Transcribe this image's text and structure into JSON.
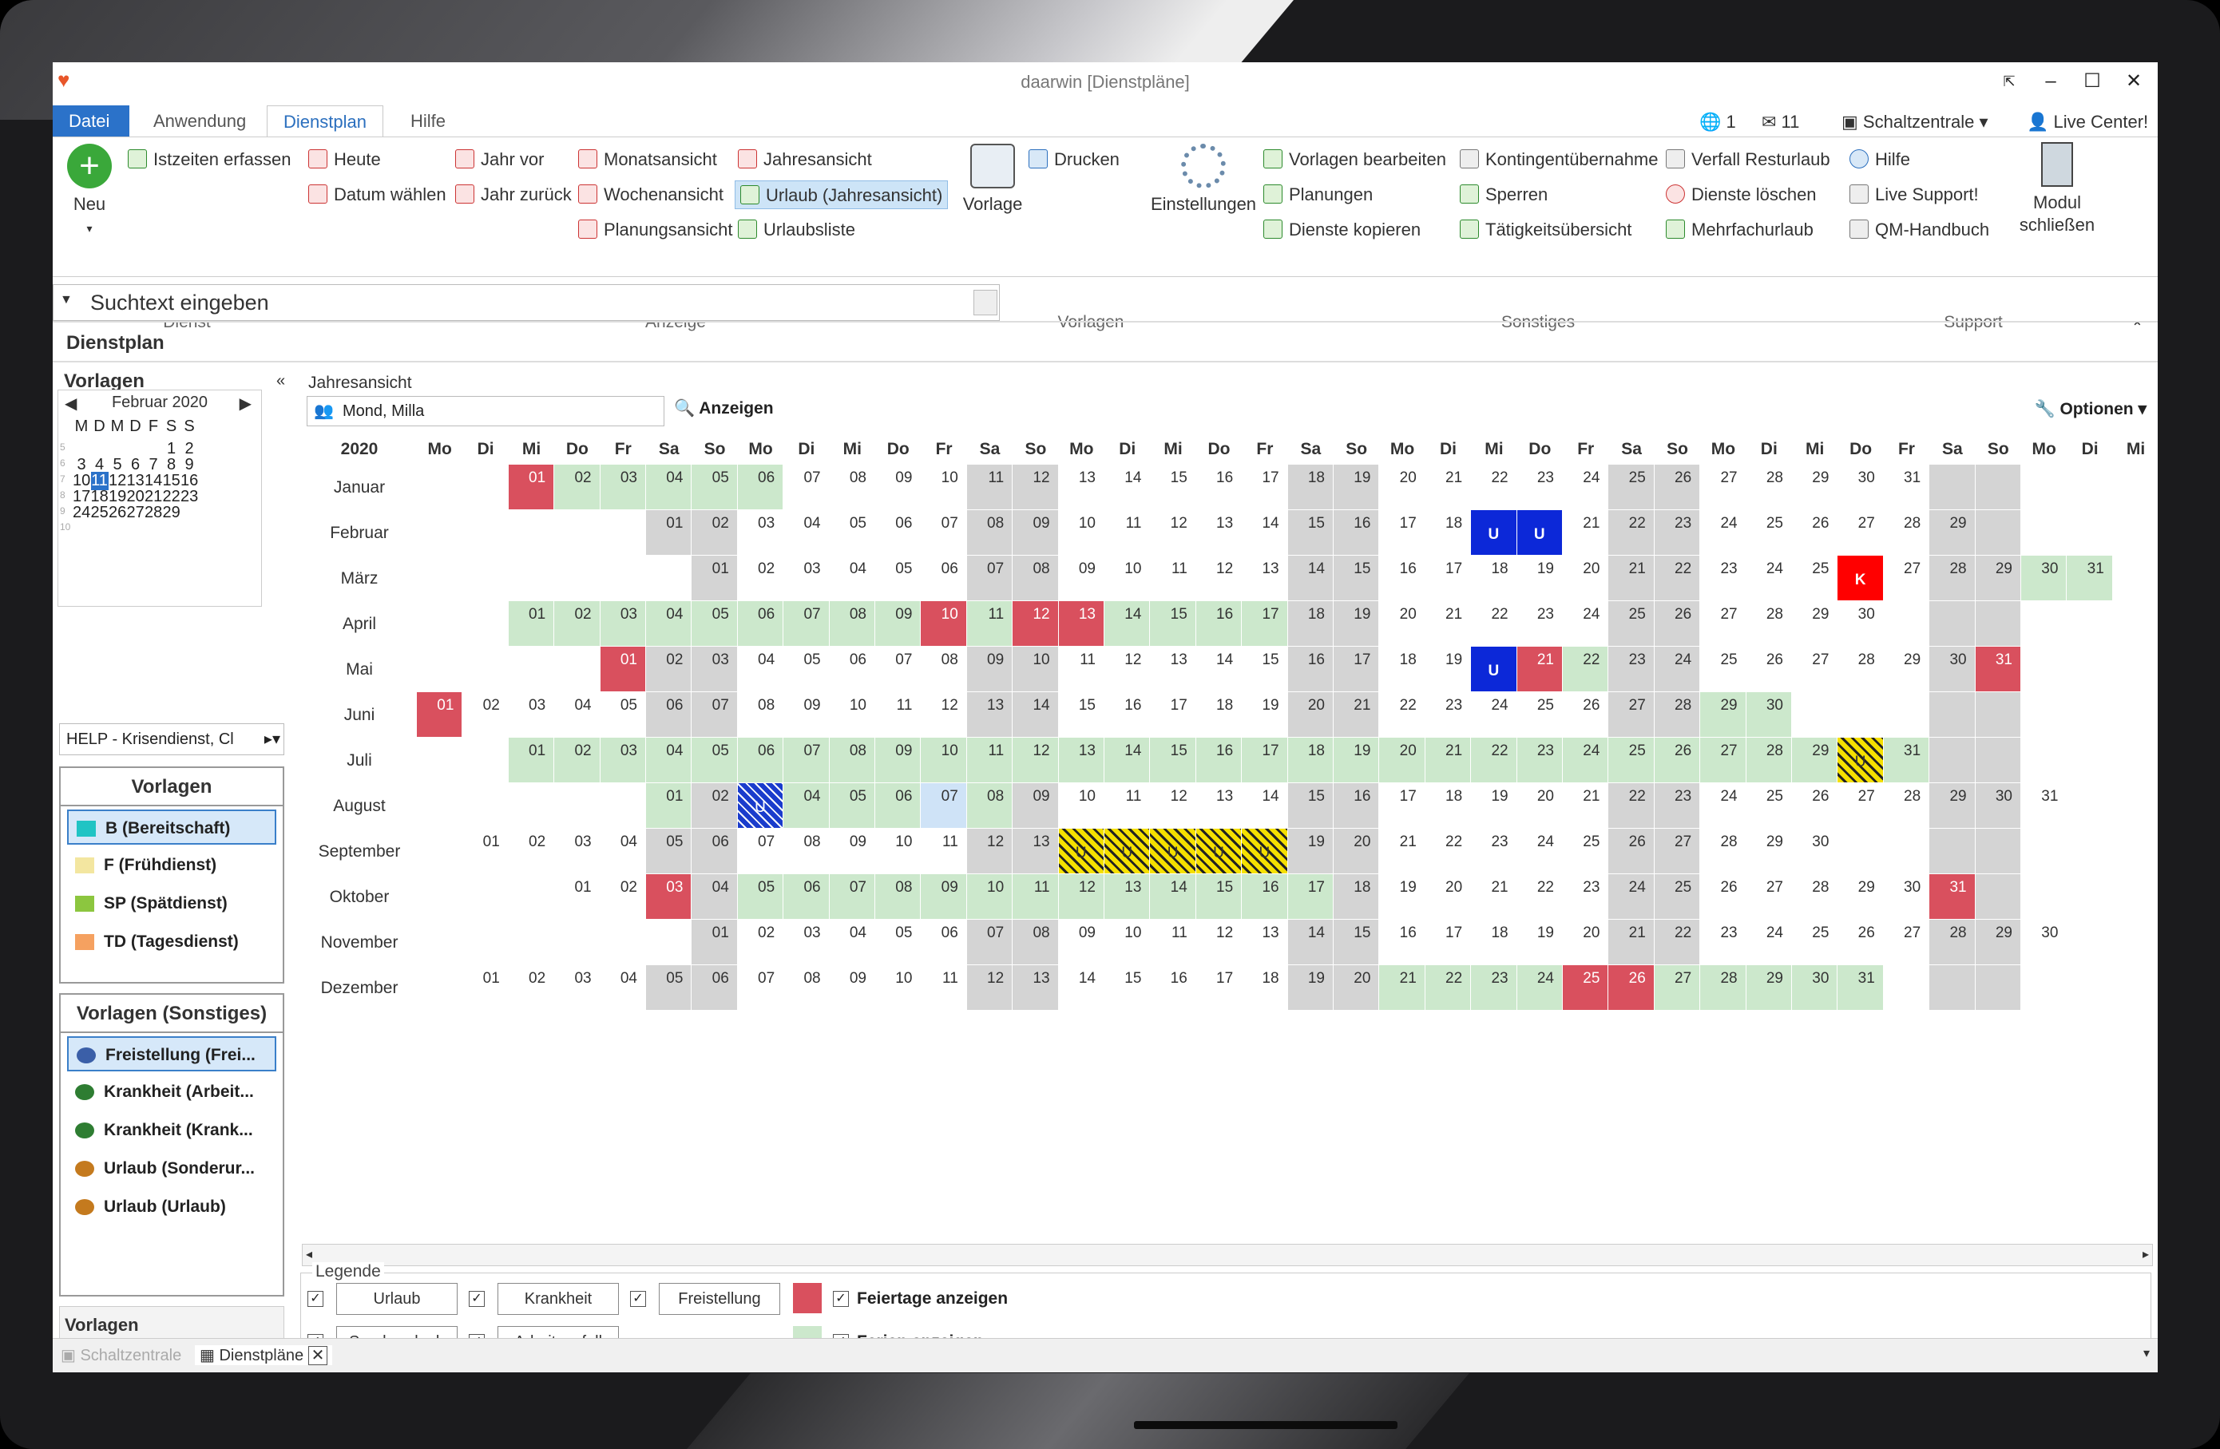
{
  "window": {
    "title": "daarwin [Dienstpläne]"
  },
  "tabs": [
    "Datei",
    "Anwendung",
    "Dienstplan",
    "Hilfe"
  ],
  "quick": {
    "c1": "1",
    "c2": "11",
    "schaltzentrale": "Schaltzentrale",
    "live": "Live Center!"
  },
  "ribbon": {
    "neu": "Neu",
    "istzeiten": "Istzeiten erfassen",
    "heute": "Heute",
    "datum": "Datum wählen",
    "jahrvor": "Jahr vor",
    "jahrzurueck": "Jahr zurück",
    "monat": "Monatsansicht",
    "woche": "Wochenansicht",
    "planung": "Planungsansicht",
    "jahr": "Jahresansicht",
    "urlaubjahr": "Urlaub (Jahresansicht)",
    "urlaubsliste": "Urlaubsliste",
    "vorlage": "Vorlage",
    "drucken": "Drucken",
    "einstellungen": "Einstellungen",
    "vorlagenbearb": "Vorlagen bearbeiten",
    "planungen": "Planungen",
    "kopieren": "Dienste kopieren",
    "kontingent": "Kontingentübernahme",
    "sperren": "Sperren",
    "taetigkeit": "Tätigkeitsübersicht",
    "verfall": "Verfall Resturlaub",
    "loeschen": "Dienste löschen",
    "mehrfach": "Mehrfachurlaub",
    "hilfe": "Hilfe",
    "livesupport": "Live Support!",
    "qm": "QM-Handbuch",
    "modul1": "Modul",
    "modul2": "schließen",
    "groups": {
      "dienst": "Dienst",
      "anzeige": "Anzeige",
      "vorlagen": "Vorlagen",
      "sonstiges": "Sonstiges",
      "support": "Support"
    }
  },
  "search": {
    "placeholder": "Suchtext eingeben"
  },
  "section": "Dienstplan",
  "left": {
    "vorlagen_title": "Vorlagen",
    "mini_month": "Februar 2020",
    "mini_days": [
      "M",
      "D",
      "M",
      "D",
      "F",
      "S",
      "S"
    ],
    "combo": "HELP - Krisendienst, Cl",
    "panel1_title": "Vorlagen",
    "panel1": [
      {
        "label": "B (Bereitschaft)",
        "color": "#20c4c4"
      },
      {
        "label": "F (Frühdienst)",
        "color": "#f3e6a0"
      },
      {
        "label": "SP (Spätdienst)",
        "color": "#8cc63f"
      },
      {
        "label": "TD (Tagesdienst)",
        "color": "#f5a160"
      }
    ],
    "panel2_title": "Vorlagen (Sonstiges)",
    "panel2": [
      "Freistellung  (Frei...",
      "Krankheit  (Arbeit...",
      "Krankheit  (Krank...",
      "Urlaub  (Sonderur...",
      "Urlaub (Urlaub)"
    ],
    "bottom": "Vorlagen"
  },
  "grid": {
    "title": "Jahresansicht",
    "person": "Mond, Milla",
    "anzeigen": "Anzeigen",
    "optionen": "Optionen",
    "year": "2020",
    "weekdays": [
      "Mo",
      "Di",
      "Mi",
      "Do",
      "Fr",
      "Sa",
      "So"
    ],
    "months": [
      {
        "name": "Januar",
        "off": 2,
        "days": 31
      },
      {
        "name": "Februar",
        "off": 5,
        "days": 29
      },
      {
        "name": "März",
        "off": 6,
        "days": 31
      },
      {
        "name": "April",
        "off": 2,
        "days": 30
      },
      {
        "name": "Mai",
        "off": 4,
        "days": 31
      },
      {
        "name": "Juni",
        "off": 0,
        "days": 30
      },
      {
        "name": "Juli",
        "off": 2,
        "days": 31
      },
      {
        "name": "August",
        "off": 5,
        "days": 31
      },
      {
        "name": "September",
        "off": 1,
        "days": 30
      },
      {
        "name": "Oktober",
        "off": 3,
        "days": 31
      },
      {
        "name": "November",
        "off": 6,
        "days": 30
      },
      {
        "name": "Dezember",
        "off": 1,
        "days": 31
      }
    ],
    "ferien": {
      "0": [
        2,
        3,
        4,
        5,
        6
      ],
      "3": [
        1,
        2,
        3,
        4,
        5,
        6,
        7,
        8,
        9,
        11,
        14,
        15,
        16,
        17
      ],
      "4": [
        22
      ],
      "5": [
        29,
        30
      ],
      "6": [
        1,
        2,
        3,
        4,
        5,
        6,
        7,
        8,
        9,
        10,
        11,
        12,
        13,
        14,
        15,
        16,
        17,
        18,
        19,
        20,
        21,
        22,
        23,
        24,
        25,
        26,
        27,
        28,
        29,
        31
      ],
      "7": [
        1,
        3,
        4,
        5,
        6,
        8
      ],
      "2": [
        30,
        31
      ],
      "9": [
        5,
        6,
        7,
        8,
        9,
        10,
        11,
        12,
        13,
        14,
        15,
        16,
        17
      ],
      "11": [
        21,
        22,
        23,
        24,
        27,
        28,
        29,
        30,
        31
      ]
    },
    "holidays": {
      "0": [
        1
      ],
      "3": [
        10,
        12,
        13
      ],
      "4": [
        1,
        21,
        31
      ],
      "5": [
        1
      ],
      "9": [
        3,
        31
      ],
      "11": [
        25,
        26
      ]
    },
    "urlaub": {
      "1": [
        19,
        20
      ],
      "4": [
        20
      ]
    },
    "krank": {
      "2": [
        26
      ]
    },
    "hatch": {
      "8": [
        14,
        15,
        16,
        17,
        18
      ],
      "6": [
        30
      ]
    },
    "hatchb": {
      "7": [
        3
      ]
    },
    "lightblue": {
      "7": [
        7
      ]
    }
  },
  "legend": {
    "title": "Legende",
    "urlaub": "Urlaub",
    "krankheit": "Krankheit",
    "freistellung": "Freistellung",
    "sonderurlaub": "Sonderurlaub",
    "arbeitsunfall": "Arbeitsunfall",
    "feiertage": "Feiertage anzeigen",
    "ferien": "Ferien anzeigen"
  },
  "statusbar": {
    "t1": "Schaltzentrale",
    "t2": "Dienstpläne"
  }
}
